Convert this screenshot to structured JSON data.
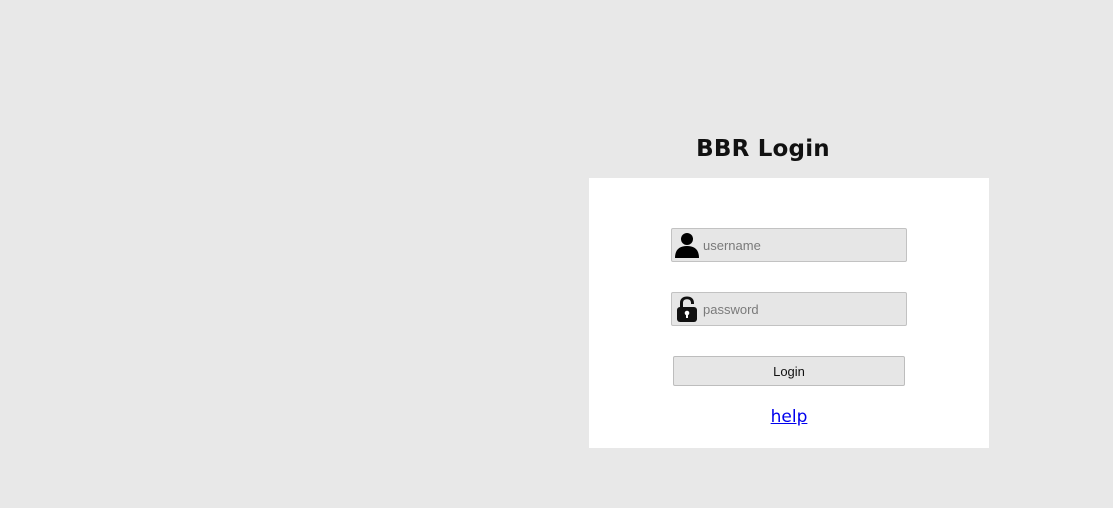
{
  "page": {
    "title": "BBR Login"
  },
  "login": {
    "username_placeholder": "username",
    "username_icon": "user-icon",
    "password_placeholder": "password",
    "password_icon": "lock-icon",
    "button_label": "Login",
    "help_label": "help"
  },
  "colors": {
    "background": "#e8e8e8",
    "panel": "#ffffff",
    "field": "#e6e6e6",
    "link": "#0000ee"
  }
}
